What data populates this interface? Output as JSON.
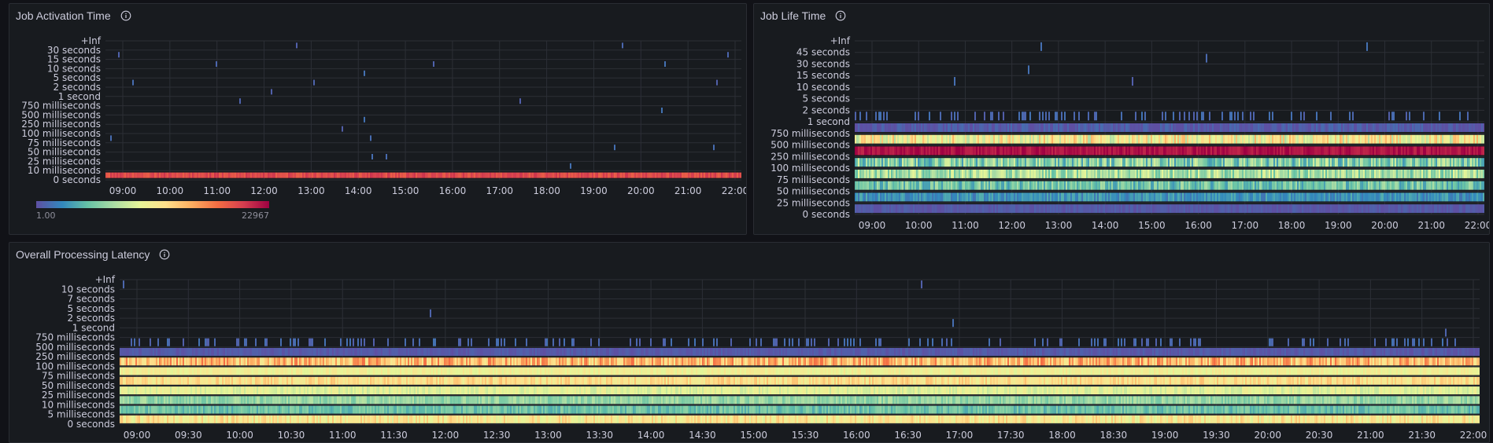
{
  "panels": [
    {
      "id": "job-activation-time",
      "title": "Job Activation Time",
      "y_labels": [
        "+Inf",
        "30 seconds",
        "15 seconds",
        "10 seconds",
        "5 seconds",
        "2 seconds",
        "1 second",
        "750 milliseconds",
        "500 milliseconds",
        "250 milliseconds",
        "100 milliseconds",
        "75 milliseconds",
        "50 milliseconds",
        "25 milliseconds",
        "10 milliseconds",
        "0 seconds"
      ],
      "x_labels": [
        "09:00",
        "10:00",
        "11:00",
        "12:00",
        "13:00",
        "14:00",
        "15:00",
        "16:00",
        "17:00",
        "18:00",
        "19:00",
        "20:00",
        "21:00",
        "22:00"
      ],
      "legend": {
        "min": "1.00",
        "max": "22967"
      }
    },
    {
      "id": "job-life-time",
      "title": "Job Life Time",
      "y_labels": [
        "+Inf",
        "45 seconds",
        "30 seconds",
        "15 seconds",
        "10 seconds",
        "5 seconds",
        "2 seconds",
        "1 second",
        "750 milliseconds",
        "500 milliseconds",
        "250 milliseconds",
        "100 milliseconds",
        "75 milliseconds",
        "50 milliseconds",
        "25 milliseconds",
        "0 seconds"
      ],
      "x_labels": [
        "09:00",
        "10:00",
        "11:00",
        "12:00",
        "13:00",
        "14:00",
        "15:00",
        "16:00",
        "17:00",
        "18:00",
        "19:00",
        "20:00",
        "21:00",
        "22:00"
      ]
    },
    {
      "id": "overall-processing-latency",
      "title": "Overall Processing Latency",
      "y_labels": [
        "+Inf",
        "10 seconds",
        "7 seconds",
        "5 seconds",
        "2 seconds",
        "1 second",
        "750 milliseconds",
        "500 milliseconds",
        "250 milliseconds",
        "100 milliseconds",
        "75 milliseconds",
        "50 milliseconds",
        "25 milliseconds",
        "10 milliseconds",
        "5 milliseconds",
        "0 seconds"
      ],
      "x_labels": [
        "09:00",
        "09:30",
        "10:00",
        "10:30",
        "11:00",
        "11:30",
        "12:00",
        "12:30",
        "13:00",
        "13:30",
        "14:00",
        "14:30",
        "15:00",
        "15:30",
        "16:00",
        "16:30",
        "17:00",
        "17:30",
        "18:00",
        "18:30",
        "19:00",
        "19:30",
        "20:00",
        "20:30",
        "21:00",
        "21:30",
        "22:00"
      ]
    }
  ],
  "colors": {
    "background": "#111217",
    "panel_bg": "#181b1f",
    "panel_border": "#2a2d33",
    "grid": "#2c2f36",
    "text": "#ccccdc",
    "scale": [
      "#5e4fa2",
      "#3288bd",
      "#66c2a5",
      "#abdda4",
      "#e6f598",
      "#fee08b",
      "#fdae61",
      "#f46d43",
      "#d53e4f",
      "#9e0142"
    ]
  }
}
